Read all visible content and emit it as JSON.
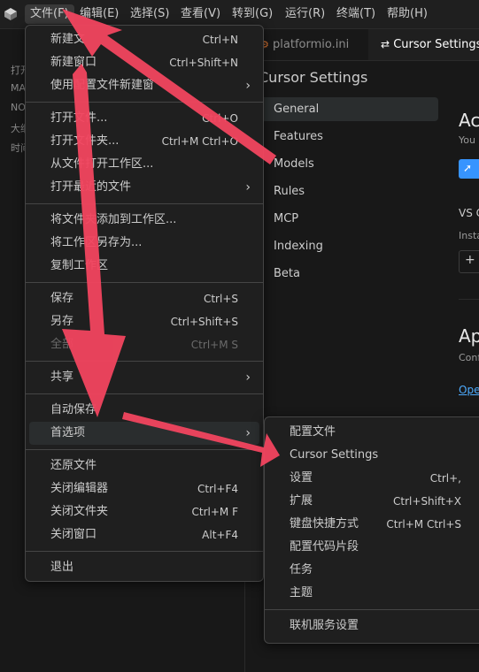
{
  "menubar": {
    "items": [
      "文件(F)",
      "编辑(E)",
      "选择(S)",
      "查看(V)",
      "转到(G)",
      "运行(R)",
      "终端(T)",
      "帮助(H)"
    ]
  },
  "sidebar": {
    "lines": [
      "打开",
      "MA",
      "NO",
      "大纲",
      "时间"
    ]
  },
  "tabs": {
    "inactive_label": "platformio.ini",
    "active_label": "Cursor Settings"
  },
  "settings": {
    "title": "Cursor Settings",
    "nav": [
      "General",
      "Features",
      "Models",
      "Rules",
      "MCP",
      "Indexing",
      "Beta"
    ],
    "right": {
      "heading1": "Ac",
      "sub1": "You a",
      "vs": "VS C",
      "insta": "Insta",
      "heading2": "Ap",
      "conf": "Conf",
      "open": "Ope"
    }
  },
  "file_menu": {
    "groups": [
      [
        {
          "label": "新建文",
          "key": "Ctrl+N"
        },
        {
          "label": "新建窗口",
          "key": "Ctrl+Shift+N"
        },
        {
          "label": "使用配置文件新建窗",
          "key": "",
          "submenu": true
        }
      ],
      [
        {
          "label": "打开文件...",
          "key": "Ctrl+O"
        },
        {
          "label": "打开文件夹...",
          "key": "Ctrl+M Ctrl+O"
        },
        {
          "label": "从文件打开工作区...",
          "key": ""
        },
        {
          "label": "打开最近的文件",
          "key": "",
          "submenu": true
        }
      ],
      [
        {
          "label": "将文件夹添加到工作区...",
          "key": ""
        },
        {
          "label": "将工作区另存为...",
          "key": ""
        },
        {
          "label": "复制工作区",
          "key": ""
        }
      ],
      [
        {
          "label": "保存",
          "key": "Ctrl+S"
        },
        {
          "label": "另存",
          "key": "Ctrl+Shift+S"
        },
        {
          "label": "全部",
          "key": "Ctrl+M S",
          "disabled": true
        }
      ],
      [
        {
          "label": "共享",
          "key": "",
          "submenu": true
        }
      ],
      [
        {
          "label": "自动保存",
          "key": ""
        },
        {
          "label": "首选项",
          "key": "",
          "submenu": true,
          "highlighted": true
        }
      ],
      [
        {
          "label": "还原文件",
          "key": ""
        },
        {
          "label": "关闭编辑器",
          "key": "Ctrl+F4"
        },
        {
          "label": "关闭文件夹",
          "key": "Ctrl+M F"
        },
        {
          "label": "关闭窗口",
          "key": "Alt+F4"
        }
      ],
      [
        {
          "label": "退出",
          "key": ""
        }
      ]
    ]
  },
  "preferences_menu": {
    "groups": [
      [
        {
          "label": "配置文件",
          "key": ""
        },
        {
          "label": "Cursor Settings",
          "key": ""
        },
        {
          "label": "设置",
          "key": "Ctrl+,"
        },
        {
          "label": "扩展",
          "key": "Ctrl+Shift+X"
        },
        {
          "label": "键盘快捷方式",
          "key": "Ctrl+M Ctrl+S"
        },
        {
          "label": "配置代码片段",
          "key": ""
        },
        {
          "label": "任务",
          "key": ""
        },
        {
          "label": "主题",
          "key": ""
        }
      ],
      [
        {
          "label": "联机服务设置",
          "key": ""
        }
      ]
    ]
  },
  "colors": {
    "annotation_arrow": "#f2455f",
    "accent": "#3794ff"
  }
}
